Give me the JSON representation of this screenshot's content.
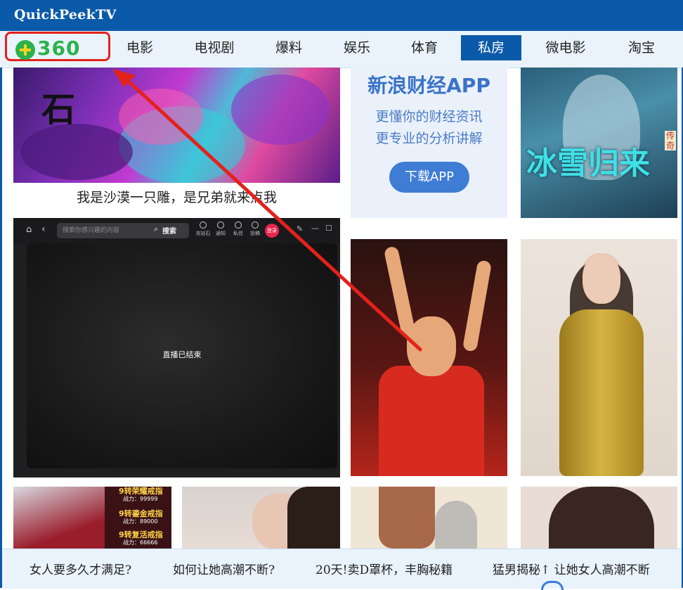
{
  "window": {
    "title": "QuickPeekTV"
  },
  "logo": {
    "text": "360",
    "icon": "360-logo-icon"
  },
  "nav": {
    "items": [
      {
        "label": "电影"
      },
      {
        "label": "电视剧"
      },
      {
        "label": "爆料"
      },
      {
        "label": "娱乐"
      },
      {
        "label": "体育"
      },
      {
        "label": "私房",
        "active": true
      },
      {
        "label": "微电影"
      },
      {
        "label": "淘宝"
      }
    ]
  },
  "tiles": {
    "game_banner_caption": "我是沙漠一只雕，是兄弟就来点我",
    "game_banner_glyph": "石",
    "sina_ad": {
      "title": "新浪财经APP",
      "line1": "更懂你的财经资讯",
      "line2": "更专业的分析讲解",
      "button": "下载APP"
    },
    "drama_poster": {
      "title": "冰雪归来",
      "badge": "传奇"
    }
  },
  "player": {
    "search_placeholder": "搜索你感兴趣的内容",
    "search_button": "搜索",
    "icons": [
      {
        "label": "充钻石"
      },
      {
        "label": "通知"
      },
      {
        "label": "私信"
      },
      {
        "label": "投稿"
      }
    ],
    "login": "登录",
    "status": "直播已结束"
  },
  "ad_row": {
    "game_items": [
      "9转荣耀戒指",
      "9转鎏金戒指",
      "9转复活戒指"
    ],
    "game_powers": [
      "战力：99999",
      "战力：89000",
      "战力：66666"
    ]
  },
  "marquee": {
    "items": [
      "女人要多久才满足?",
      "如何让她高潮不断?",
      "20天!卖D罩杯，丰胸秘籍",
      "猛男揭秘↑ 让她女人高潮不断"
    ]
  },
  "colors": {
    "titlebar": "#0b5aa9",
    "nav_active": "#0b5aa9",
    "highlight_red": "#e3221b",
    "logo_green": "#2bb24c"
  }
}
